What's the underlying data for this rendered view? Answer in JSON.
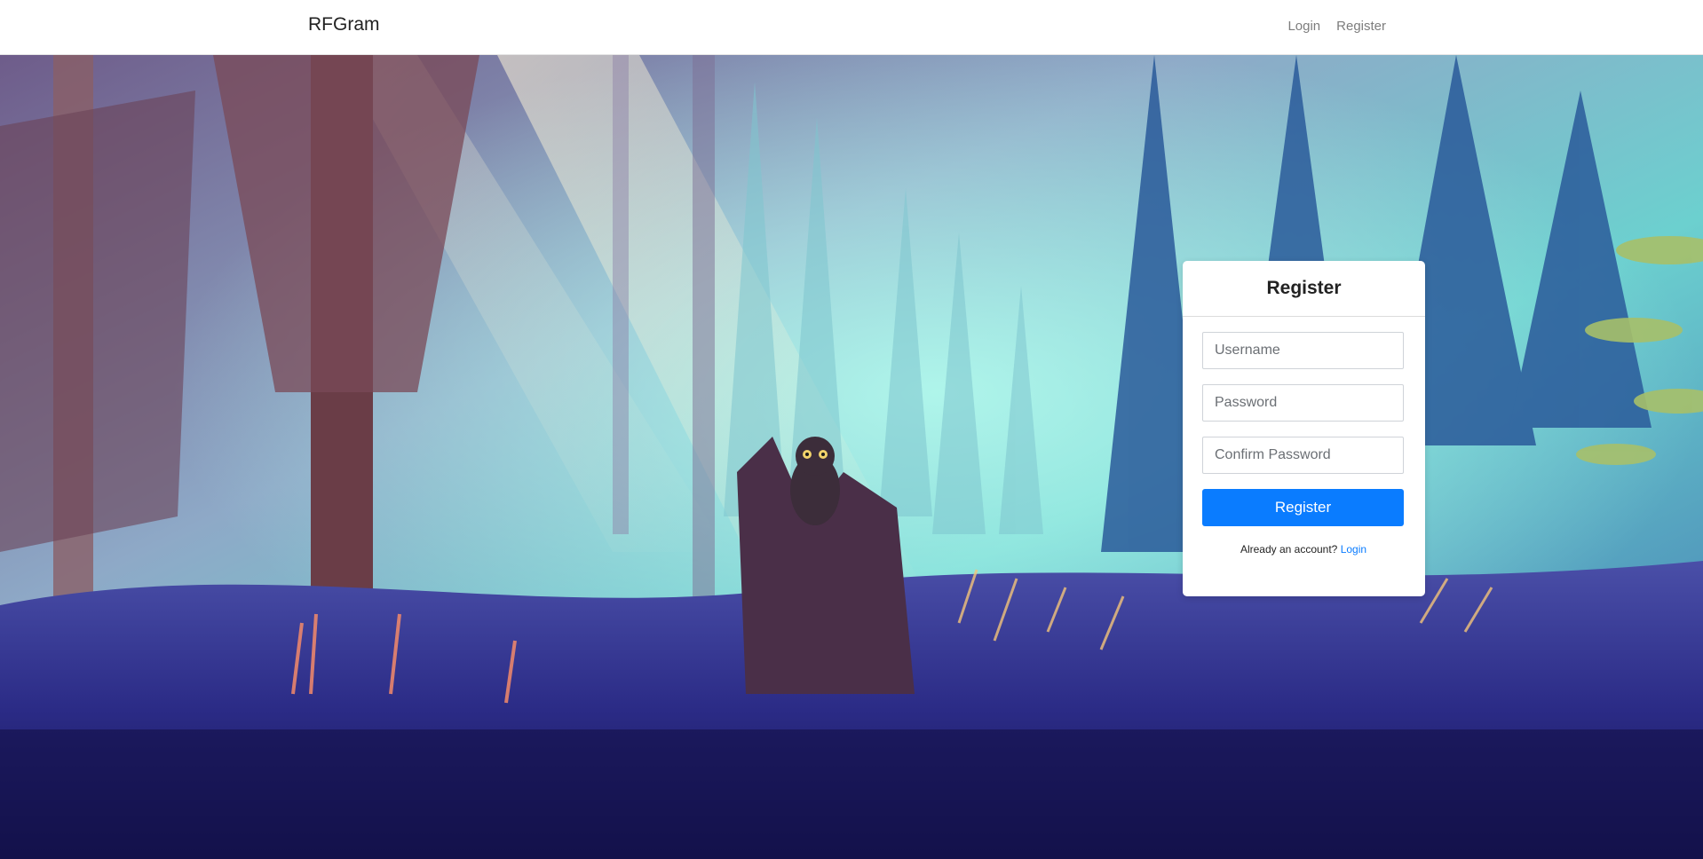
{
  "navbar": {
    "brand": "RFGram",
    "links": [
      {
        "label": "Login"
      },
      {
        "label": "Register"
      }
    ]
  },
  "register_form": {
    "title": "Register",
    "username_placeholder": "Username",
    "password_placeholder": "Password",
    "confirm_password_placeholder": "Confirm Password",
    "submit_label": "Register",
    "already_account_text": "Already an account?",
    "login_link_label": "Login"
  },
  "colors": {
    "accent": "#0a7cff",
    "navbar_bg": "#ffffff",
    "card_bg": "#ffffff"
  },
  "background": {
    "description_icon": "forest-owl-illustration"
  }
}
